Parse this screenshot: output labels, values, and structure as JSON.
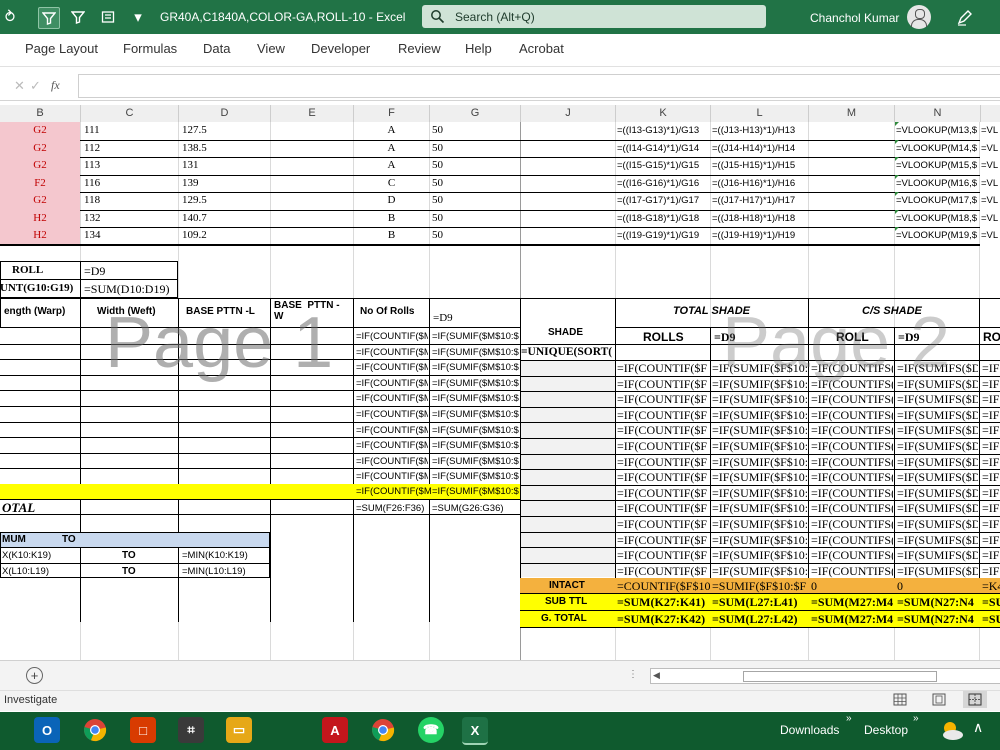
{
  "window": {
    "title": "GR40A,C1840A,COLOR-GA,ROLL-10  -  Excel",
    "user": "Chanchol Kumar"
  },
  "search": {
    "placeholder": "Search (Alt+Q)"
  },
  "ribbon": {
    "tabs": [
      "Page Layout",
      "Formulas",
      "Data",
      "View",
      "Developer",
      "Review",
      "Help",
      "Acrobat"
    ]
  },
  "formula_bar": {
    "fx": "fx",
    "value": ""
  },
  "columns": [
    "B",
    "C",
    "D",
    "E",
    "F",
    "G",
    "J",
    "K",
    "L",
    "M",
    "N"
  ],
  "top_rows": [
    {
      "b": "G2",
      "c": "111",
      "d": "127.5",
      "f": "A",
      "g": "50",
      "k": "=((I13-G13)*1)/G13",
      "l": "=((J13-H13)*1)/H13",
      "n": "=VLOOKUP(M13,$",
      "o": "=VL"
    },
    {
      "b": "G2",
      "c": "112",
      "d": "138.5",
      "f": "A",
      "g": "50",
      "k": "=((I14-G14)*1)/G14",
      "l": "=((J14-H14)*1)/H14",
      "n": "=VLOOKUP(M14,$",
      "o": "=VL"
    },
    {
      "b": "G2",
      "c": "113",
      "d": "131",
      "f": "A",
      "g": "50",
      "k": "=((I15-G15)*1)/G15",
      "l": "=((J15-H15)*1)/H15",
      "n": "=VLOOKUP(M15,$",
      "o": "=VL"
    },
    {
      "b": "F2",
      "c": "116",
      "d": "139",
      "f": "C",
      "g": "50",
      "k": "=((I16-G16)*1)/G16",
      "l": "=((J16-H16)*1)/H16",
      "n": "=VLOOKUP(M16,$",
      "o": "=VL"
    },
    {
      "b": "G2",
      "c": "118",
      "d": "129.5",
      "f": "D",
      "g": "50",
      "k": "=((I17-G17)*1)/G17",
      "l": "=((J17-H17)*1)/H17",
      "n": "=VLOOKUP(M17,$",
      "o": "=VL"
    },
    {
      "b": "H2",
      "c": "132",
      "d": "140.7",
      "f": "B",
      "g": "50",
      "k": "=((I18-G18)*1)/G18",
      "l": "=((J18-H18)*1)/H18",
      "n": "=VLOOKUP(M18,$",
      "o": "=VL"
    },
    {
      "b": "H2",
      "c": "134",
      "d": "109.2",
      "f": "B",
      "g": "50",
      "k": "=((I19-G19)*1)/G19",
      "l": "=((J19-H19)*1)/H19",
      "n": "=VLOOKUP(M19,$",
      "o": "=VL"
    }
  ],
  "roll_box": {
    "roll_label": "ROLL",
    "roll_value": "=D9",
    "count_label": "UNT(G10:G19)",
    "count_value": "=SUM(D10:D19)"
  },
  "left_table": {
    "headers": [
      "ength (Warp)",
      "Width (Weft)",
      "BASE PTTN -L",
      "BASE  PTTN -\nW",
      "No Of Rolls",
      "=D9"
    ],
    "f_formula": "=IF(COUNTIF($M",
    "g_formula": "=IF(SUMIF($M$10:$",
    "total_label": "OTAL",
    "total_f": "=SUM(F26:F36)",
    "total_g": "=SUM(G26:G36)"
  },
  "min_max": {
    "header_a": "MUM",
    "header_b": "TO",
    "rows": [
      {
        "a": "X(K10:K19)",
        "to": "TO",
        "b": "=MIN(K10:K19)"
      },
      {
        "a": "X(L10:L19)",
        "to": "TO",
        "b": "=MIN(L10:L19)"
      }
    ]
  },
  "right_table": {
    "total_shade": "TOTAL SHADE",
    "cs_shade": "C/S SHADE",
    "shade": "SHADE",
    "rolls": "ROLLS",
    "d9": "=D9",
    "roll": "ROLL",
    "d9b": "=D9",
    "ro": "RO",
    "unique": "=UNIQUE(SORT(",
    "k_formula": "=IF(COUNTIF($F",
    "l_formula": "=IF(SUMIF($F$10:",
    "m_formula": "=IF(COUNTIFS(",
    "n_formula": "=IF(SUMIFS($D",
    "o_formula": "=IF",
    "intact": {
      "label": "INTACT",
      "k": "=COUNTIF($F$10",
      "l": "=SUMIF($F$10:$F",
      "m": "0",
      "n": "0",
      "o": "=K4"
    },
    "subttl": {
      "label": "SUB TTL",
      "k": "=SUM(K27:K41)",
      "l": "=SUM(L27:L41)",
      "m": "=SUM(M27:M4",
      "n": "=SUM(N27:N4",
      "o": "=SU"
    },
    "gtotal": {
      "label": "G. TOTAL",
      "k": "=SUM(K27:K42)",
      "l": "=SUM(L27:L42)",
      "m": "=SUM(M27:M4",
      "n": "=SUM(N27:N4",
      "o": "=SU"
    }
  },
  "watermarks": {
    "page1": "Page 1",
    "page2": "Page 2"
  },
  "status": {
    "left": "Investigate"
  },
  "taskbar": {
    "downloads": "Downloads",
    "desktop": "Desktop"
  },
  "colors": {
    "excel_green": "#217346",
    "pink": "#f4c7ce",
    "yellow": "#ffff00",
    "orange": "#f4b13e",
    "header_blue": "#c9d9ef"
  }
}
